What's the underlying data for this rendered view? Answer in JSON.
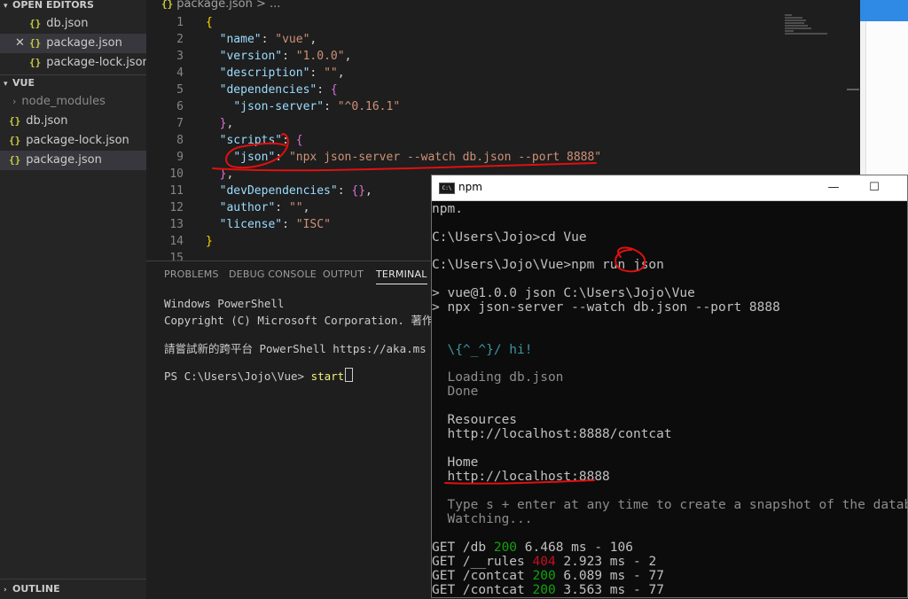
{
  "sidebar": {
    "open_editors_label": "OPEN EDITORS",
    "open_editors": [
      {
        "name": "db.json"
      },
      {
        "name": "package.json"
      },
      {
        "name": "package-lock.json"
      }
    ],
    "folder_label": "VUE",
    "files": [
      {
        "name": "node_modules"
      },
      {
        "name": "db.json"
      },
      {
        "name": "package-lock.json"
      },
      {
        "name": "package.json"
      }
    ],
    "outline_label": "OUTLINE",
    "close_glyph": "✕",
    "braces_glyph": "{}"
  },
  "editor": {
    "breadcrumb_file": "package.json",
    "breadcrumb_rest": "> ...",
    "line_numbers": [
      "1",
      "2",
      "3",
      "4",
      "5",
      "6",
      "7",
      "8",
      "9",
      "10",
      "11",
      "12",
      "13",
      "14",
      "15"
    ],
    "lines": {
      "l1": {
        "open": "{"
      },
      "l2": {
        "key": "\"name\"",
        "colon": ": ",
        "val": "\"vue\"",
        "end": ","
      },
      "l3": {
        "key": "\"version\"",
        "colon": ": ",
        "val": "\"1.0.0\"",
        "end": ","
      },
      "l4": {
        "key": "\"description\"",
        "colon": ": ",
        "val": "\"\"",
        "end": ","
      },
      "l5": {
        "key": "\"dependencies\"",
        "colon": ": ",
        "open": "{"
      },
      "l6": {
        "key": "\"json-server\"",
        "colon": ": ",
        "val": "\"^0.16.1\""
      },
      "l7": {
        "close": "}",
        "end": ","
      },
      "l8": {
        "key": "\"scripts\"",
        "colon": ": ",
        "open": "{"
      },
      "l9": {
        "key": "\"json\"",
        "colon": ": ",
        "val": "\"npx json-server --watch db.json --port 8888\""
      },
      "l10": {
        "close": "}",
        "end": ","
      },
      "l11": {
        "key": "\"devDependencies\"",
        "colon": ": ",
        "val": "{}",
        "end": ","
      },
      "l12": {
        "key": "\"author\"",
        "colon": ": ",
        "val": "\"\"",
        "end": ","
      },
      "l13": {
        "key": "\"license\"",
        "colon": ": ",
        "val": "\"ISC\""
      },
      "l14": {
        "close": "}"
      }
    }
  },
  "panel": {
    "tabs": [
      "PROBLEMS",
      "DEBUG CONSOLE",
      "OUTPUT",
      "TERMINAL"
    ],
    "terminal": {
      "line1": "Windows PowerShell",
      "line2": "Copyright (C) Microsoft Corporation. 著作權",
      "line3": "請嘗試新的跨平台 PowerShell https://aka.ms",
      "prompt": "PS C:\\Users\\Jojo\\Vue> ",
      "command": "start"
    }
  },
  "npm_window": {
    "title": "npm",
    "app_icon_text": "C:\\",
    "min_glyph": "—",
    "max_glyph": "☐",
    "lines": {
      "a": "npm.",
      "b": "C:\\Users\\Jojo>cd Vue",
      "c": "C:\\Users\\Jojo\\Vue>npm run json",
      "d": "> vue@1.0.0 json C:\\Users\\Jojo\\Vue",
      "e": "> npx json-server --watch db.json --port 8888",
      "f": "  \\{^_^}/ hi!",
      "g": "  Loading db.json",
      "h": "  Done",
      "i": "  Resources",
      "j": "  http://localhost:8888/contcat",
      "k": "  Home",
      "l": "  http://localhost:8888",
      "m": "  Type s + enter at any time to create a snapshot of the database",
      "n": "  Watching...",
      "log": [
        {
          "method": "GET /db ",
          "status": "200",
          "rest": " 6.468 ms - 106",
          "status_color": "#13a10e"
        },
        {
          "method": "GET /__rules ",
          "status": "404",
          "rest": " 2.923 ms - 2",
          "status_color": "#c50f1f"
        },
        {
          "method": "GET /contcat ",
          "status": "200",
          "rest": " 6.089 ms - 77",
          "status_color": "#13a10e"
        },
        {
          "method": "GET /contcat ",
          "status": "200",
          "rest": " 3.563 ms - 77",
          "status_color": "#13a10e"
        }
      ]
    }
  },
  "colors": {
    "annotation": "#e01010",
    "sidebar_bg": "#252526",
    "editor_bg": "#1e1e1e"
  }
}
